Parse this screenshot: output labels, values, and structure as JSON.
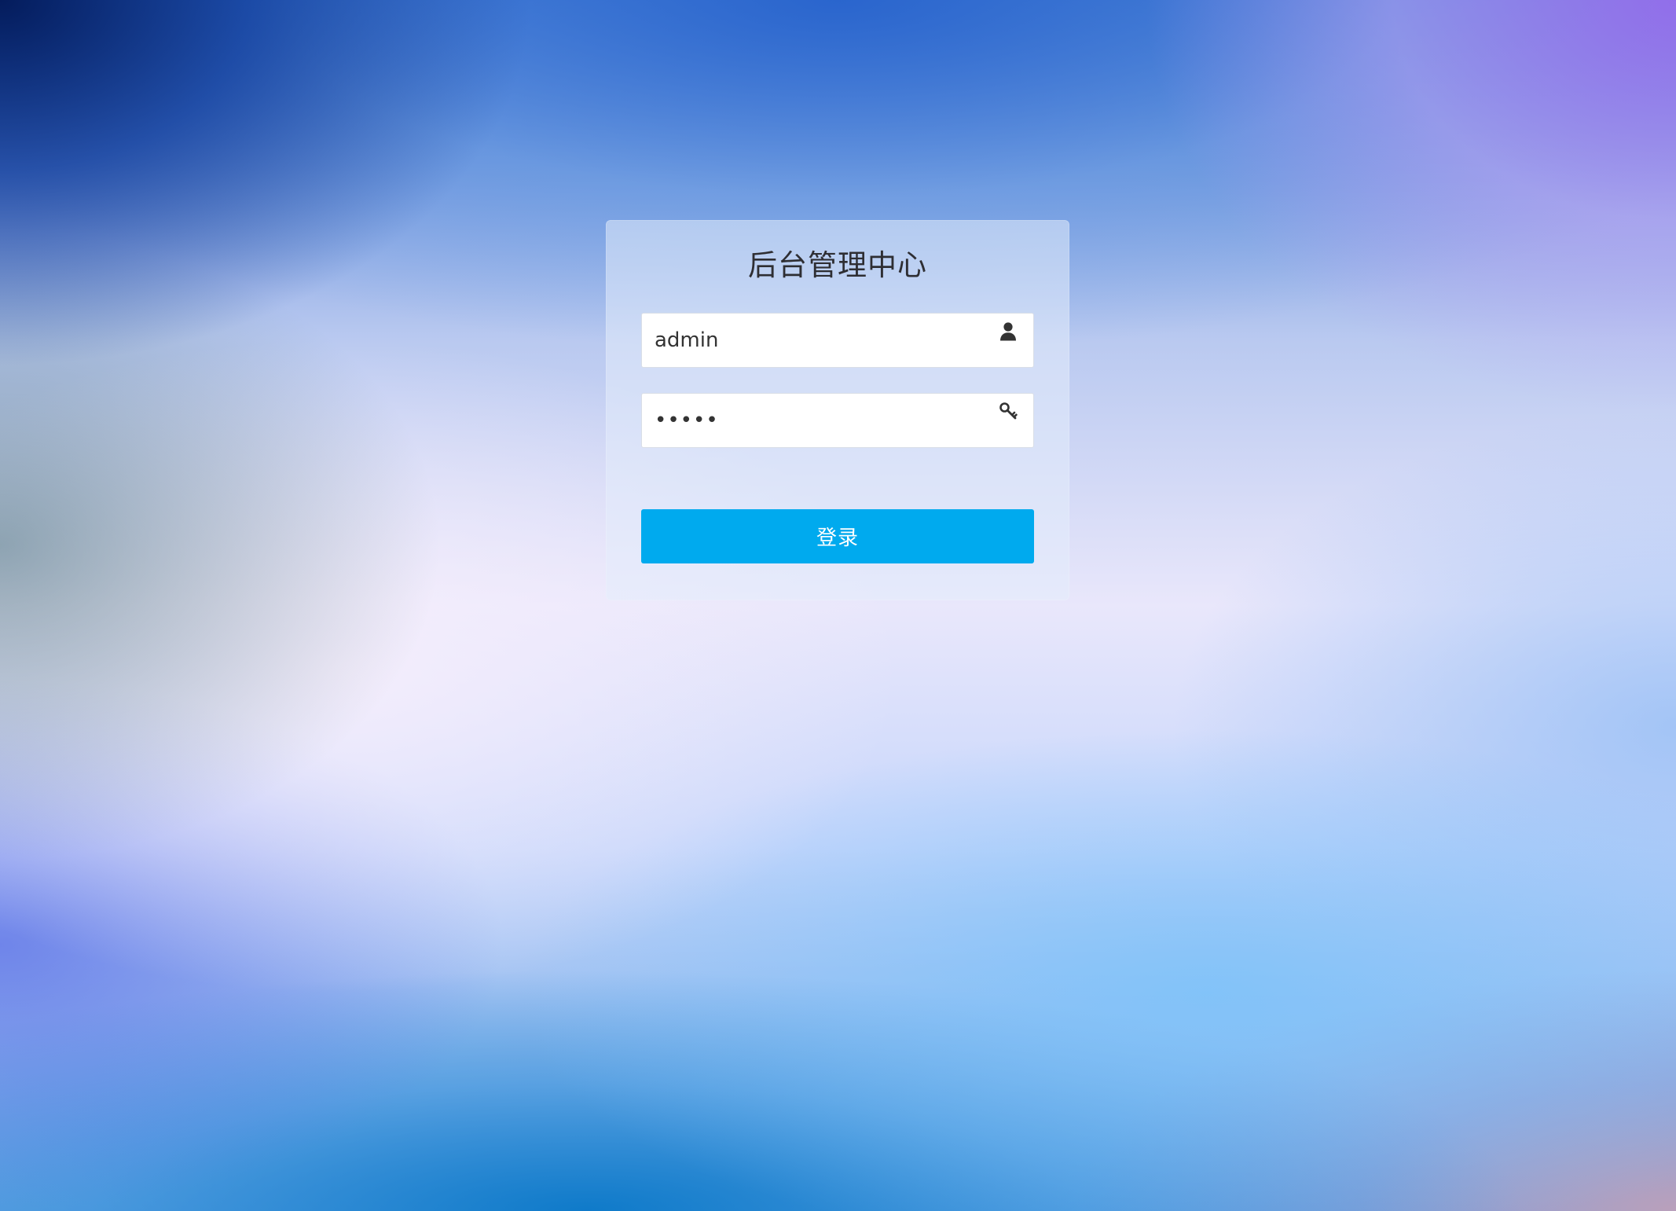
{
  "login": {
    "title": "后台管理中心",
    "username": {
      "value": "admin",
      "icon": "user-icon"
    },
    "password": {
      "value": "admin",
      "icon": "key-icon"
    },
    "submit_label": "登录",
    "colors": {
      "button": "#00aaee",
      "title": "#2e2e33"
    }
  }
}
